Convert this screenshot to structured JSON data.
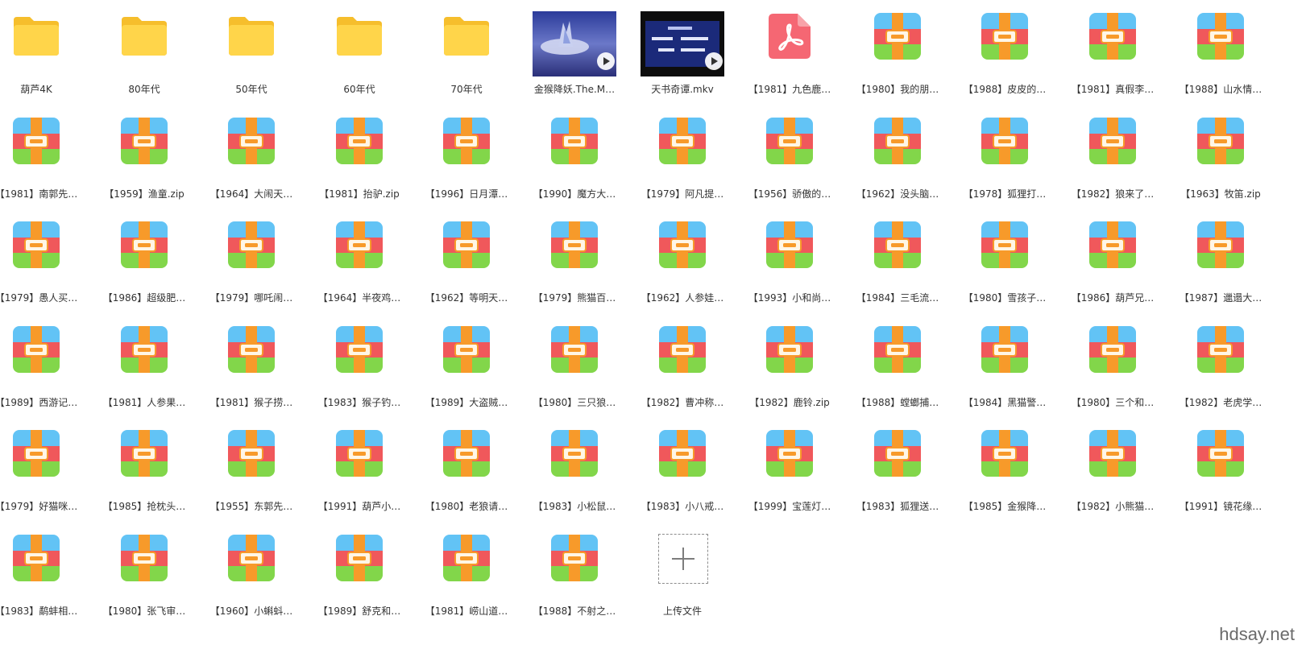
{
  "files": [
    {
      "type": "folder",
      "name": "葫芦4K"
    },
    {
      "type": "folder",
      "name": "80年代"
    },
    {
      "type": "folder",
      "name": "50年代"
    },
    {
      "type": "folder",
      "name": "60年代"
    },
    {
      "type": "folder",
      "name": "70年代"
    },
    {
      "type": "video",
      "name": "金猴降妖.The.M…",
      "thumb": "sky"
    },
    {
      "type": "video",
      "name": "天书奇谭.mkv",
      "thumb": "title"
    },
    {
      "type": "pdf",
      "name": "【1981】九色鹿…"
    },
    {
      "type": "zip",
      "name": "【1980】我的朋…"
    },
    {
      "type": "zip",
      "name": "【1988】皮皮的…"
    },
    {
      "type": "zip",
      "name": "【1981】真假李…"
    },
    {
      "type": "zip",
      "name": "【1988】山水情…"
    },
    {
      "type": "zip",
      "name": "【1981】南郭先…"
    },
    {
      "type": "zip",
      "name": "【1959】渔童.zip"
    },
    {
      "type": "zip",
      "name": "【1964】大闹天…"
    },
    {
      "type": "zip",
      "name": "【1981】抬驴.zip"
    },
    {
      "type": "zip",
      "name": "【1996】日月潭…"
    },
    {
      "type": "zip",
      "name": "【1990】魔方大…"
    },
    {
      "type": "zip",
      "name": "【1979】阿凡提…"
    },
    {
      "type": "zip",
      "name": "【1956】骄傲的…"
    },
    {
      "type": "zip",
      "name": "【1962】没头脑…"
    },
    {
      "type": "zip",
      "name": "【1978】狐狸打…"
    },
    {
      "type": "zip",
      "name": "【1982】狼来了…"
    },
    {
      "type": "zip",
      "name": "【1963】牧笛.zip"
    },
    {
      "type": "zip",
      "name": "【1979】愚人买…"
    },
    {
      "type": "zip",
      "name": "【1986】超级肥…"
    },
    {
      "type": "zip",
      "name": "【1979】哪吒闹…"
    },
    {
      "type": "zip",
      "name": "【1964】半夜鸡…"
    },
    {
      "type": "zip",
      "name": "【1962】等明天…"
    },
    {
      "type": "zip",
      "name": "【1979】熊猫百…"
    },
    {
      "type": "zip",
      "name": "【1962】人参娃…"
    },
    {
      "type": "zip",
      "name": "【1993】小和尚…"
    },
    {
      "type": "zip",
      "name": "【1984】三毛流…"
    },
    {
      "type": "zip",
      "name": "【1980】雪孩子…"
    },
    {
      "type": "zip",
      "name": "【1986】葫芦兄…"
    },
    {
      "type": "zip",
      "name": "【1987】邋遢大…"
    },
    {
      "type": "zip",
      "name": "【1989】西游记…"
    },
    {
      "type": "zip",
      "name": "【1981】人参果…"
    },
    {
      "type": "zip",
      "name": "【1981】猴子捞…"
    },
    {
      "type": "zip",
      "name": "【1983】猴子钓…"
    },
    {
      "type": "zip",
      "name": "【1989】大盗贼…"
    },
    {
      "type": "zip",
      "name": "【1980】三只狼…"
    },
    {
      "type": "zip",
      "name": "【1982】曹冲称…"
    },
    {
      "type": "zip",
      "name": "【1982】鹿铃.zip"
    },
    {
      "type": "zip",
      "name": "【1988】螳螂捕…"
    },
    {
      "type": "zip",
      "name": "【1984】黑猫警…"
    },
    {
      "type": "zip",
      "name": "【1980】三个和…"
    },
    {
      "type": "zip",
      "name": "【1982】老虎学…"
    },
    {
      "type": "zip",
      "name": "【1979】好猫咪…"
    },
    {
      "type": "zip",
      "name": "【1985】抢枕头…"
    },
    {
      "type": "zip",
      "name": "【1955】东郭先…"
    },
    {
      "type": "zip",
      "name": "【1991】葫芦小…"
    },
    {
      "type": "zip",
      "name": "【1980】老狼请…"
    },
    {
      "type": "zip",
      "name": "【1983】小松鼠…"
    },
    {
      "type": "zip",
      "name": "【1983】小八戒…"
    },
    {
      "type": "zip",
      "name": "【1999】宝莲灯…"
    },
    {
      "type": "zip",
      "name": "【1983】狐狸送…"
    },
    {
      "type": "zip",
      "name": "【1985】金猴降…"
    },
    {
      "type": "zip",
      "name": "【1982】小熊猫…"
    },
    {
      "type": "zip",
      "name": "【1991】镜花缘…"
    },
    {
      "type": "zip",
      "name": "【1983】鹬蚌相…"
    },
    {
      "type": "zip",
      "name": "【1980】张飞审…"
    },
    {
      "type": "zip",
      "name": "【1960】小蝌蚪…"
    },
    {
      "type": "zip",
      "name": "【1989】舒克和…"
    },
    {
      "type": "zip",
      "name": "【1981】崂山道…"
    },
    {
      "type": "zip",
      "name": "【1988】不射之…"
    }
  ],
  "upload": {
    "label": "上传文件"
  },
  "watermark": "hdsay.net",
  "colors": {
    "folder_back": "#F6BE2C",
    "folder_front": "#FFD54A",
    "zip_top": "#62C3F5",
    "zip_mid": "#F0585B",
    "zip_bot": "#82D64A",
    "zip_strap": "#F79A2A",
    "pdf": "#F56773",
    "thumb_sky": "#3A4EA6",
    "thumb_title": "#1B2A7A"
  },
  "icons": {
    "folder": "folder-icon",
    "zip": "zip-archive-icon",
    "pdf": "pdf-icon",
    "video": "video-thumbnail",
    "upload": "plus-icon"
  }
}
